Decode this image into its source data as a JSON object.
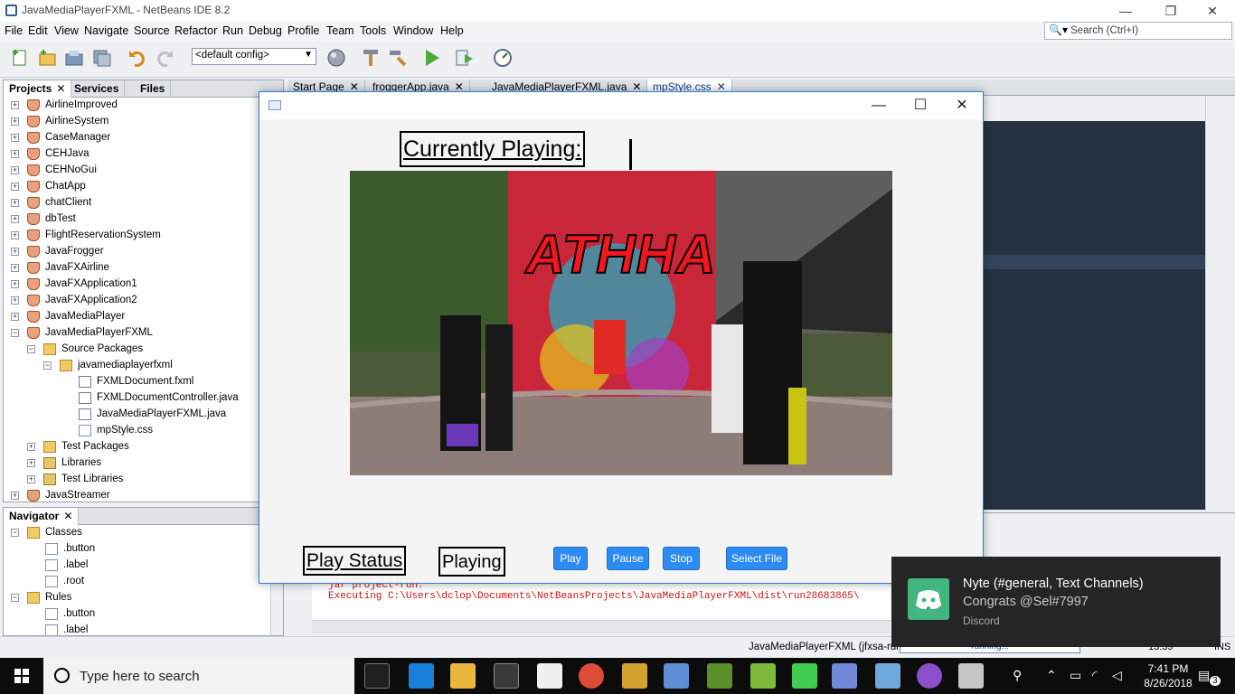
{
  "ide": {
    "title": "JavaMediaPlayerFXML - NetBeans IDE 8.2",
    "window_controls": [
      "—",
      "❐",
      "✕"
    ],
    "menus": [
      "File",
      "Edit",
      "View",
      "Navigate",
      "Source",
      "Refactor",
      "Run",
      "Debug",
      "Profile",
      "Team",
      "Tools",
      "Window",
      "Help"
    ],
    "search_placeholder": "Search (Ctrl+I)",
    "config_value": "<default config>",
    "accent_color": "#2f5d93"
  },
  "projects_panel": {
    "tabs": [
      "Projects",
      "Services",
      "Files"
    ],
    "tab_close": "✕",
    "nodes": [
      {
        "label": "AirlineImproved",
        "icon": "cup"
      },
      {
        "label": "AirlineSystem",
        "icon": "cup"
      },
      {
        "label": "CaseManager",
        "icon": "cup"
      },
      {
        "label": "CEHJava",
        "icon": "cup"
      },
      {
        "label": "CEHNoGui",
        "icon": "cup"
      },
      {
        "label": "ChatApp",
        "icon": "cup"
      },
      {
        "label": "chatClient",
        "icon": "cup"
      },
      {
        "label": "dbTest",
        "icon": "cup"
      },
      {
        "label": "FlightReservationSystem",
        "icon": "cup"
      },
      {
        "label": "JavaFrogger",
        "icon": "cup"
      },
      {
        "label": "JavaFXAirline",
        "icon": "cup"
      },
      {
        "label": "JavaFXApplication1",
        "icon": "cup"
      },
      {
        "label": "JavaFXApplication2",
        "icon": "cup"
      },
      {
        "label": "JavaMediaPlayer",
        "icon": "cup"
      },
      {
        "label": "JavaMediaPlayerFXML",
        "icon": "cup"
      },
      {
        "label": "Source Packages",
        "icon": "folder"
      },
      {
        "label": "javamediaplayerfxml",
        "icon": "folder"
      },
      {
        "label": "FXMLDocument.fxml",
        "icon": "file"
      },
      {
        "label": "FXMLDocumentController.java",
        "icon": "file"
      },
      {
        "label": "JavaMediaPlayerFXML.java",
        "icon": "file"
      },
      {
        "label": "mpStyle.css",
        "icon": "css"
      },
      {
        "label": "Test Packages",
        "icon": "folder"
      },
      {
        "label": "Libraries",
        "icon": "jar"
      },
      {
        "label": "Test Libraries",
        "icon": "jar"
      },
      {
        "label": "JavaStreamer",
        "icon": "cup"
      }
    ]
  },
  "navigator_panel": {
    "title": "Navigator",
    "nodes": [
      {
        "label": "Classes",
        "icon": "folder"
      },
      {
        "label": ".button",
        "icon": "css"
      },
      {
        "label": ".label",
        "icon": "css"
      },
      {
        "label": ".root",
        "icon": "css"
      },
      {
        "label": "Rules",
        "icon": "folder"
      },
      {
        "label": ".button",
        "icon": "css"
      },
      {
        "label": ".label",
        "icon": "css"
      }
    ]
  },
  "editor_tabs": [
    {
      "label": "Start Page",
      "active": false
    },
    {
      "label": "froggerApp.java",
      "active": false
    },
    {
      "label": "JavaMediaPlayerFXML.java",
      "active": false
    },
    {
      "label": "mpStyle.css",
      "active": true
    }
  ],
  "output": {
    "line1": "jar project-run:",
    "line2": "Executing C:\\Users\\dclop\\Documents\\NetBeansProjects\\JavaMediaPlayerFXML\\dist\\run28683865\\"
  },
  "statusbar": {
    "run_label": "JavaMediaPlayerFXML (jfxsa-run)",
    "progress_label": "running...",
    "position": "13:39",
    "mode": "INS"
  },
  "player": {
    "currently_playing_label": "Currently Playing:",
    "overlay_text": "ATHHA",
    "play_status_label": "Play Status",
    "status_value": "Playing",
    "buttons": {
      "play": "Play",
      "pause": "Pause",
      "stop": "Stop",
      "select": "Select File"
    },
    "button_color": "#2c8cf2"
  },
  "toast": {
    "title": "Nyte (#general, Text Channels)",
    "message": "Congrats @Sel#7997",
    "app": "Discord",
    "brand_color": "#43b581"
  },
  "taskbar": {
    "search_placeholder": "Type here to search",
    "time": "7:41 PM",
    "date": "8/26/2018",
    "notification_count": "3"
  }
}
